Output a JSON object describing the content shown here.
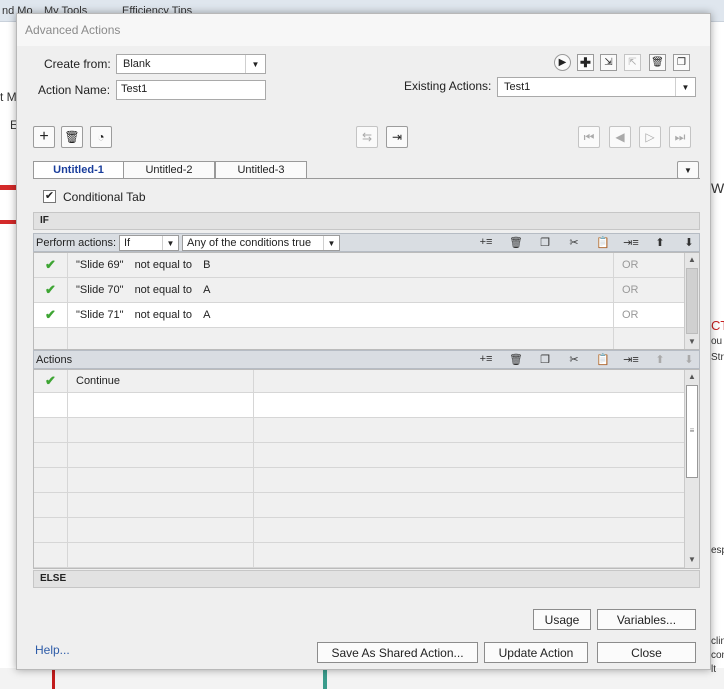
{
  "background": {
    "topbar": [
      "nd Mo",
      "My Tools",
      "Efficiency Tips"
    ],
    "left_frag": [
      "t M",
      "E"
    ],
    "right_frag": [
      "W",
      "CT",
      "ou",
      "Str",
      "esp",
      "clin",
      "con",
      "lt"
    ]
  },
  "dialog": {
    "title": "Advanced Actions",
    "create_from_label": "Create from:",
    "create_from_value": "Blank",
    "action_name_label": "Action Name:",
    "action_name_value": "Test1",
    "existing_actions_label": "Existing Actions:",
    "existing_actions_value": "Test1",
    "tabs": [
      "Untitled-1",
      "Untitled-2",
      "Untitled-3"
    ],
    "conditional_tab_label": "Conditional Tab",
    "if_label": "IF",
    "perform_actions_label": "Perform actions:",
    "perform_mode": "If",
    "condition_mode": "Any of the conditions true",
    "conditions": [
      {
        "var": "\"Slide 69\"",
        "op": "not equal to",
        "val": "B",
        "logic": "OR"
      },
      {
        "var": "\"Slide 70\"",
        "op": "not equal to",
        "val": "A",
        "logic": "OR"
      },
      {
        "var": "\"Slide 71\"",
        "op": "not equal to",
        "val": "A",
        "logic": "OR"
      }
    ],
    "actions_label": "Actions",
    "actions": [
      {
        "name": "Continue"
      }
    ],
    "else_label": "ELSE",
    "usage_button": "Usage",
    "variables_button": "Variables...",
    "help_link": "Help...",
    "save_shared_button": "Save As Shared Action...",
    "update_button": "Update Action",
    "close_button": "Close"
  },
  "colors": {
    "accent": "#1a3e9c",
    "check": "#3ea534",
    "link": "#2e5ca8"
  }
}
